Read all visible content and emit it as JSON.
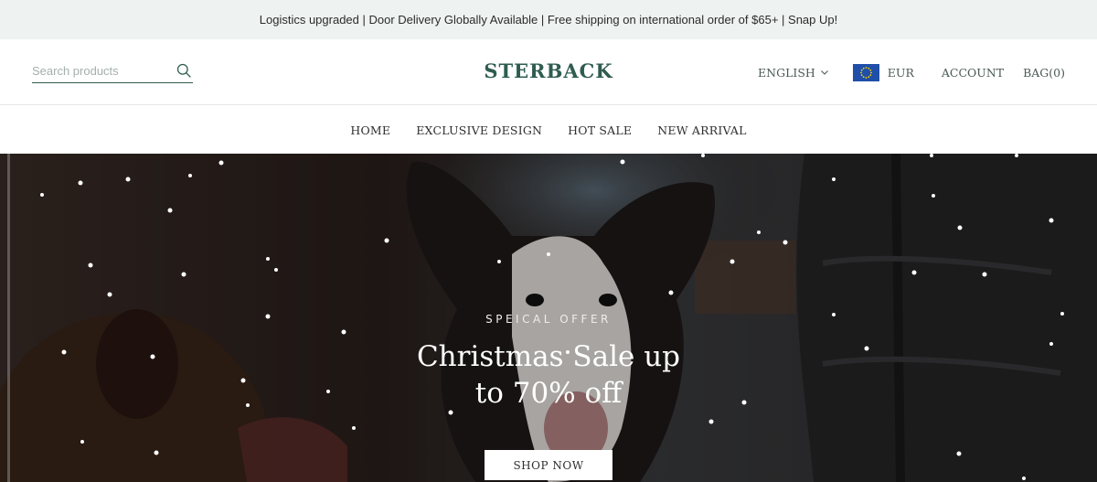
{
  "announcement": {
    "text": "Logistics upgraded | Door Delivery Globally Available | Free shipping on international order of $65+ | Snap Up!"
  },
  "header": {
    "search_placeholder": "Search products",
    "logo": "STERBACK",
    "language": "ENGLISH",
    "currency": "EUR",
    "account": "ACCOUNT",
    "bag": "BAG(0)"
  },
  "nav": {
    "items": [
      {
        "label": "HOME"
      },
      {
        "label": "EXCLUSIVE DESIGN"
      },
      {
        "label": "HOT SALE"
      },
      {
        "label": "NEW ARRIVAL"
      }
    ]
  },
  "hero": {
    "eyebrow": "SPEICAL OFFER",
    "title_line1": "Christmas Sale up",
    "title_line2": "to 70% off",
    "button": "SHOP NOW"
  },
  "colors": {
    "brand": "#2f5c50",
    "announcement_bg": "#eef2f0",
    "hero_overlay": "#2b211d"
  },
  "icons": {
    "search": "search-icon",
    "chevron": "chevron-down-icon",
    "flag": "eu-flag-icon"
  }
}
